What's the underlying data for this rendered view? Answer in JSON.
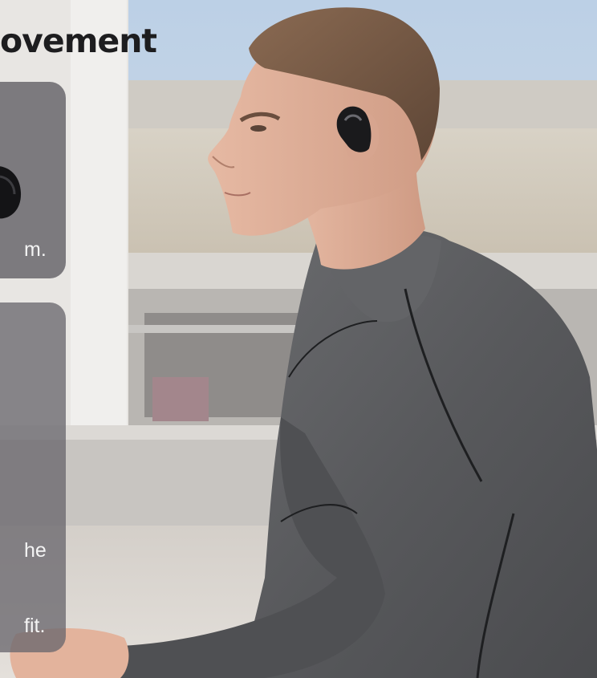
{
  "headline": "ovement",
  "cards": [
    {
      "text": "m."
    },
    {
      "lines": [
        "he",
        "fit."
      ]
    }
  ],
  "colors": {
    "headline": "#1d1d1f",
    "card_overlay": "#646268",
    "shirt": "#5c5d60",
    "sky": "#c9d6e6",
    "ground": "#cfcac4"
  },
  "image": {
    "subject": "man-in-gray-compression-shirt-wearing-open-ear-earbud"
  }
}
